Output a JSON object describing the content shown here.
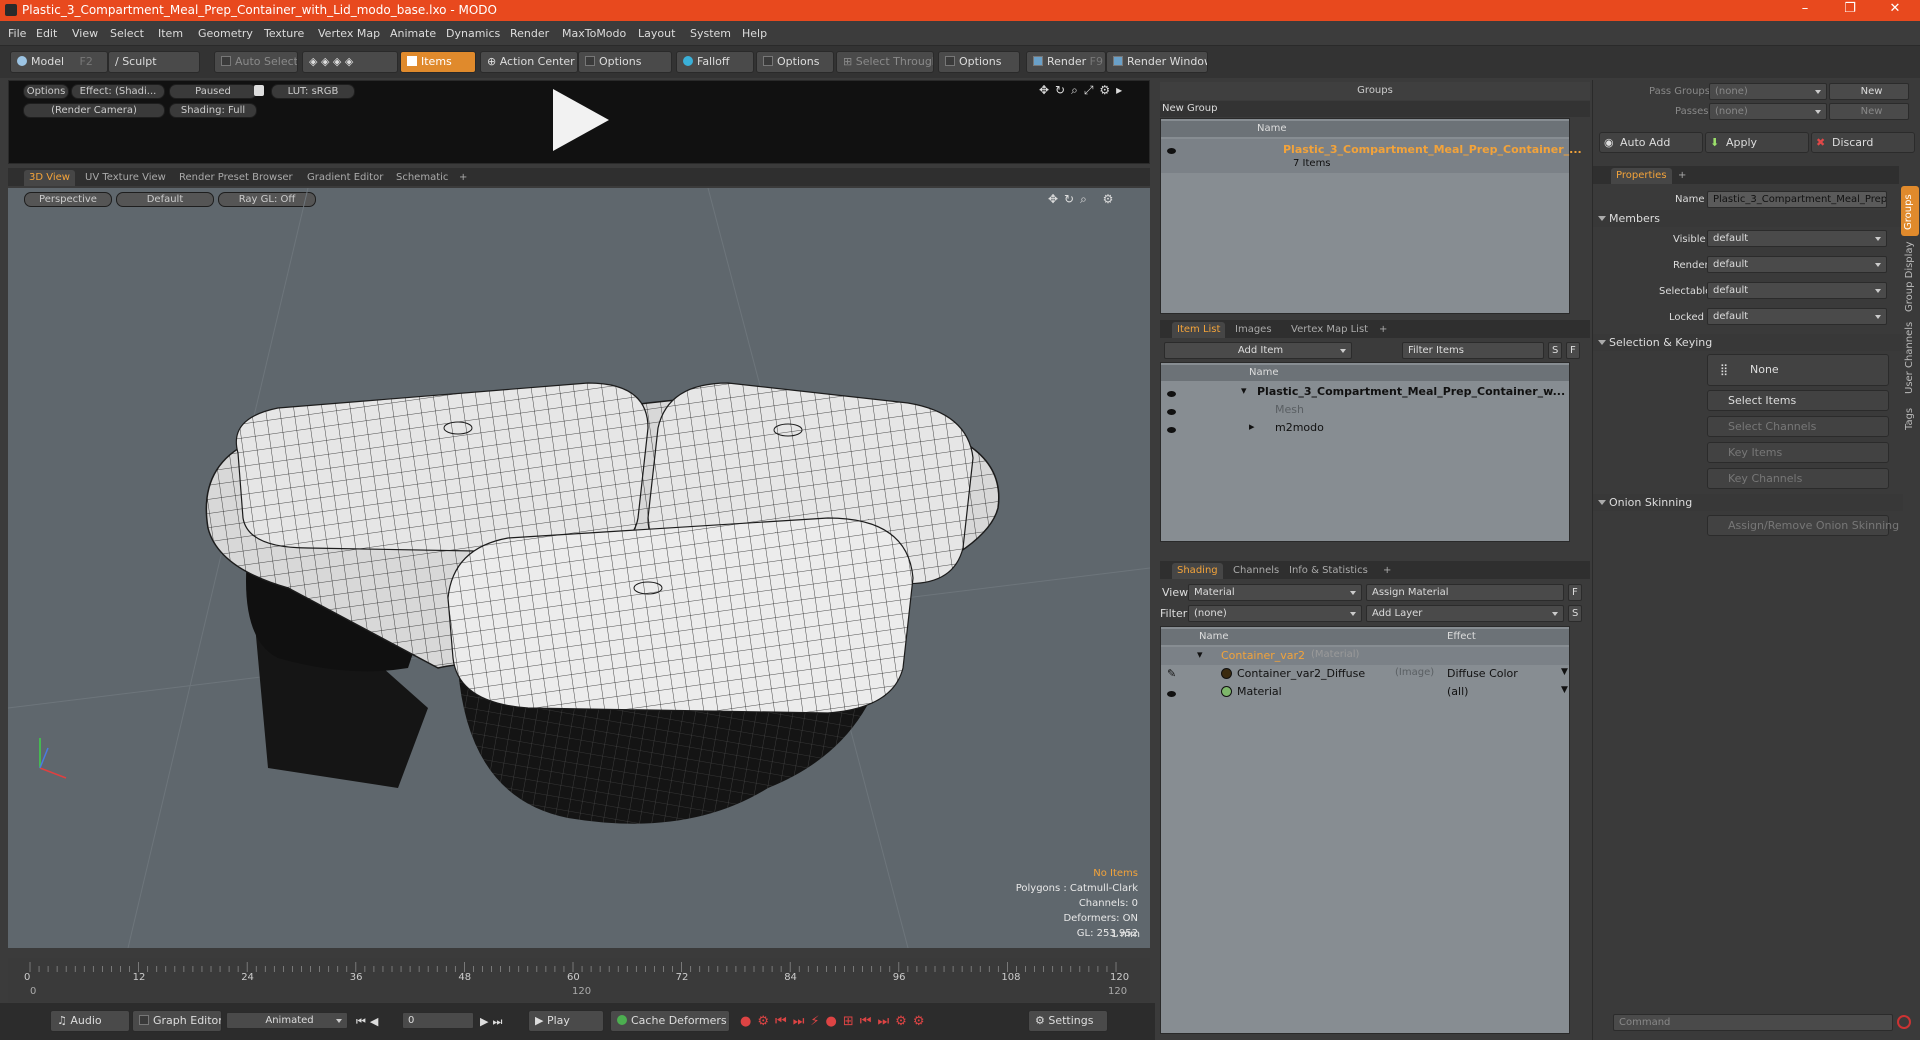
{
  "window": {
    "title": "Plastic_3_Compartment_Meal_Prep_Container_with_Lid_modo_base.lxo - MODO",
    "minimize": "–",
    "maximize": "❐",
    "close": "✕"
  },
  "menu": [
    "File",
    "Edit",
    "View",
    "Select",
    "Item",
    "Geometry",
    "Texture",
    "Vertex Map",
    "Animate",
    "Dynamics",
    "Render",
    "MaxToModo",
    "Layout",
    "System",
    "Help"
  ],
  "toolbar": {
    "model": "Model",
    "model_key": "F2",
    "sculpt": "Sculpt",
    "auto_select": "Auto Select",
    "items": "Items",
    "action_center": "Action Center",
    "options1": "Options",
    "falloff": "Falloff",
    "options2": "Options",
    "select_through": "Select Through",
    "options3": "Options",
    "render": "Render",
    "render_key": "F9",
    "render_window": "Render Window"
  },
  "preview": {
    "options": "Options",
    "effect": "Effect: (Shadi...",
    "paused": "Paused",
    "lut": "LUT: sRGB",
    "camera": "(Render Camera)",
    "shading": "Shading: Full"
  },
  "viewport_tabs": [
    "3D View",
    "UV Texture View",
    "Render Preset Browser",
    "Gradient Editor",
    "Schematic",
    "+"
  ],
  "viewport": {
    "projection": "Perspective",
    "style": "Default",
    "raygl": "Ray GL: Off",
    "info": {
      "no_items": "No Items",
      "polygons": "Polygons : Catmull-Clark",
      "channels": "Channels: 0",
      "deformers": "Deformers: ON",
      "gl": "GL: 253,952",
      "scale": "1 mm"
    }
  },
  "timeline": {
    "ticks": [
      "0",
      "12",
      "24",
      "36",
      "48",
      "60",
      "72",
      "84",
      "96",
      "108",
      "120"
    ],
    "start": "0",
    "end": "120",
    "mid": "120"
  },
  "bottom": {
    "audio": "Audio",
    "graph_editor": "Graph Editor",
    "animated": "Animated",
    "frame": "0",
    "play": "Play",
    "cache": "Cache Deformers",
    "settings": "Settings"
  },
  "groups": {
    "title": "Groups",
    "new_group": "New Group",
    "col_name": "Name",
    "item_name": "Plastic_3_Compartment_Meal_Prep_Container_...",
    "item_count": "7 Items"
  },
  "itemlist": {
    "tabs": [
      "Item List",
      "Images",
      "Vertex Map List",
      "+"
    ],
    "add_item": "Add Item",
    "filter": "Filter Items",
    "s": "S",
    "f": "F",
    "col_name": "Name",
    "rows": [
      "Plastic_3_Compartment_Meal_Prep_Container_w...",
      "Mesh",
      "m2modo"
    ]
  },
  "shading": {
    "tabs": [
      "Shading",
      "Channels",
      "Info & Statistics",
      "+"
    ],
    "view_label": "View",
    "view_value": "Material",
    "assign": "Assign Material",
    "f": "F",
    "filter_label": "Filter",
    "filter_value": "(none)",
    "add_layer": "Add Layer",
    "s": "S",
    "col_name": "Name",
    "col_effect": "Effect",
    "rows": [
      {
        "name": "Container_var2",
        "tag": "(Material)",
        "effect": ""
      },
      {
        "name": "Container_var2_Diffuse",
        "tag": "(Image)",
        "effect": "Diffuse Color"
      },
      {
        "name": "Material",
        "tag": "",
        "effect": "(all)"
      }
    ]
  },
  "right": {
    "pass_groups": "Pass Groups",
    "passes": "Passes",
    "none": "(none)",
    "new": "New",
    "auto_add": "Auto Add",
    "apply": "Apply",
    "discard": "Discard",
    "properties_tab": "Properties",
    "plus": "+",
    "name_label": "Name",
    "name_value": "Plastic_3_Compartment_Meal_Prep_",
    "members": "Members",
    "fields": [
      {
        "label": "Visible",
        "value": "default"
      },
      {
        "label": "Render",
        "value": "default"
      },
      {
        "label": "Selectable",
        "value": "default"
      },
      {
        "label": "Locked",
        "value": "default"
      }
    ],
    "selection_keying": "Selection & Keying",
    "none_btn": "None",
    "select_items": "Select Items",
    "select_channels": "Select Channels",
    "key_items": "Key Items",
    "key_channels": "Key Channels",
    "onion": "Onion Skinning",
    "assign_onion": "Assign/Remove Onion Skinning",
    "side_tabs": [
      "Groups",
      "Group Display",
      "User Channels",
      "Tags"
    ],
    "command": "Command"
  },
  "colors": {
    "accent": "#f3a33a",
    "title": "#e8491e",
    "viewport": "#5f676d",
    "panel": "#878d92"
  }
}
